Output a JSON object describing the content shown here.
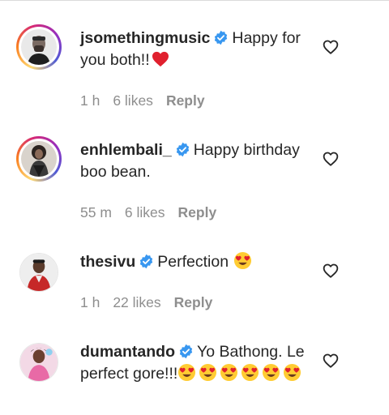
{
  "comments": [
    {
      "username": "jsomethingmusic",
      "verified": true,
      "text": "Happy for you both!!",
      "emoji_after": [
        "red-heart"
      ],
      "time": "1 h",
      "likes": "6 likes",
      "reply_label": "Reply",
      "avatar_ring": true
    },
    {
      "username": "enhlembali_",
      "verified": true,
      "text": "Happy birthday boo bean.",
      "emoji_after": [],
      "time": "55 m",
      "likes": "6 likes",
      "reply_label": "Reply",
      "avatar_ring": true
    },
    {
      "username": "thesivu",
      "verified": true,
      "text": "Perfection",
      "emoji_after": [
        "heart-eyes"
      ],
      "time": "1 h",
      "likes": "22 likes",
      "reply_label": "Reply",
      "avatar_ring": false
    },
    {
      "username": "dumantando",
      "verified": true,
      "text": "Yo Bathong. Le perfect gore!!!",
      "emoji_after": [
        "heart-eyes",
        "heart-eyes",
        "heart-eyes",
        "heart-eyes",
        "heart-eyes",
        "heart-eyes"
      ],
      "time": "",
      "likes": "",
      "reply_label": "",
      "avatar_ring": false
    }
  ],
  "colors": {
    "text": "#262626",
    "meta": "#8e8e8e",
    "verified": "#3897f0",
    "heart": "#ed1c2e",
    "emoji_face": "#ffcc33"
  },
  "icons": {
    "like": "heart-outline-icon",
    "verified": "verified-badge-icon"
  }
}
